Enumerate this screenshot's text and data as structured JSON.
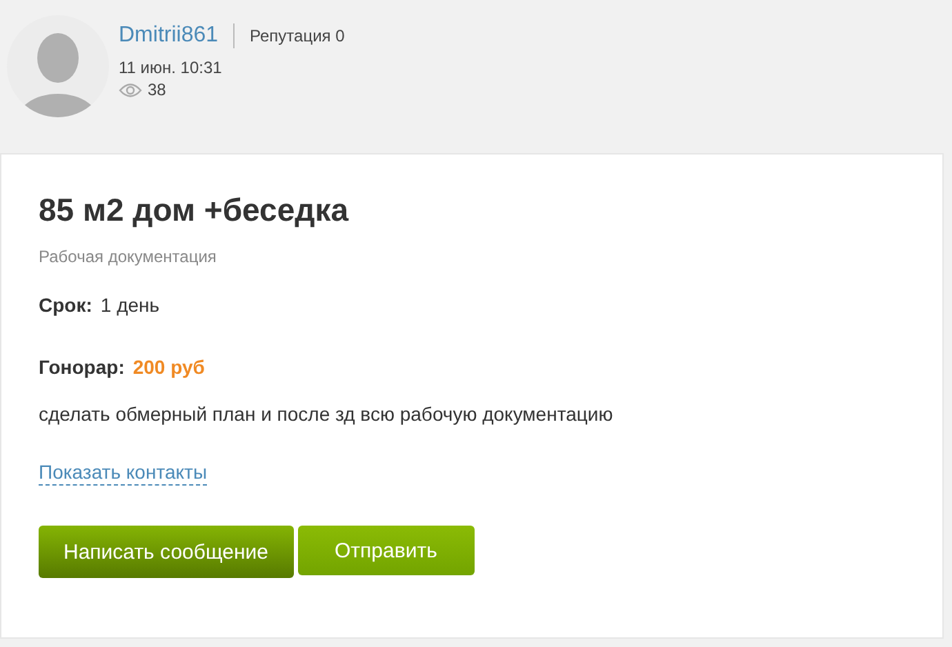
{
  "author": {
    "name": "Dmitrii861",
    "reputation": "Репутация 0",
    "date": "11 июн. 10:31",
    "views": "38"
  },
  "task": {
    "title": "85 м2 дом +беседка",
    "category": "Рабочая документация",
    "deadline": {
      "label": "Срок:",
      "value": "1 день"
    },
    "fee": {
      "label": "Гонорар:",
      "value": "200 руб"
    },
    "description": "сделать обмерный план и после зд всю рабочую документацию",
    "contacts_link": "Показать контакты",
    "buttons": [
      {
        "label": "Написать сообщение",
        "kind": "dark"
      },
      {
        "label": "Отправить",
        "kind": "light"
      }
    ]
  }
}
